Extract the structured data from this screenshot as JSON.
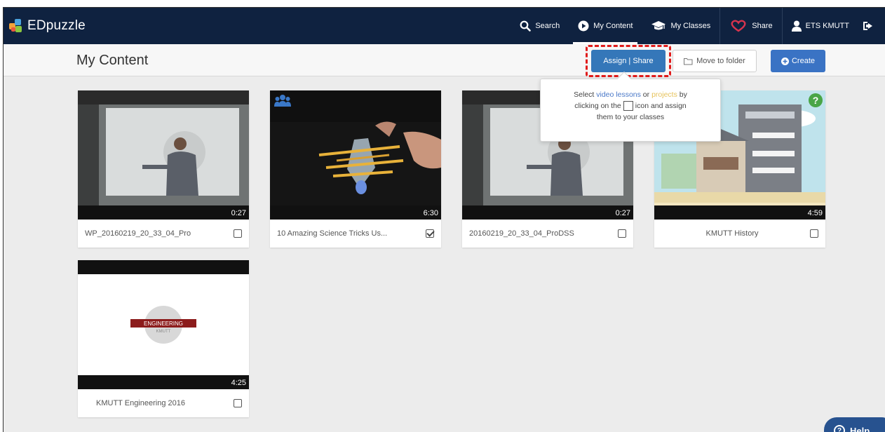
{
  "brand": {
    "name": "EDpuzzle"
  },
  "nav": {
    "search": "Search",
    "my_content": "My Content",
    "my_classes": "My Classes",
    "share": "Share",
    "user": "ETS KMUTT"
  },
  "header": {
    "title": "My Content",
    "assign_share": "Assign | Share",
    "move_to_folder": "Move to folder",
    "create": "Create"
  },
  "popover": {
    "text_1": "Select",
    "link_video_lessons": "video lessons",
    "text_or": "or",
    "link_projects": "projects",
    "text_by": "by",
    "text_clicking": "clicking on the",
    "text_icon": "icon and assign",
    "text_them": "them to your classes"
  },
  "videos": [
    {
      "title": "WP_20160219_20_33_04_Pro",
      "duration": "0:27",
      "checked": false
    },
    {
      "title": "10 Amazing Science Tricks Us...",
      "duration": "6:30",
      "checked": true
    },
    {
      "title": "20160219_20_33_04_ProDSS",
      "duration": "0:27",
      "checked": false
    },
    {
      "title": "KMUTT History",
      "duration": "4:59",
      "checked": false
    },
    {
      "title": "KMUTT Engineering 2016",
      "duration": "4:25",
      "checked": false
    }
  ],
  "thumb_text": {
    "engineering": "ENGINEERING",
    "kmutt": "KMUTT"
  },
  "help": {
    "label": "Help"
  },
  "colors": {
    "navbar": "#0f2240",
    "primary": "#3577b9",
    "highlight": "#e01b1b"
  }
}
